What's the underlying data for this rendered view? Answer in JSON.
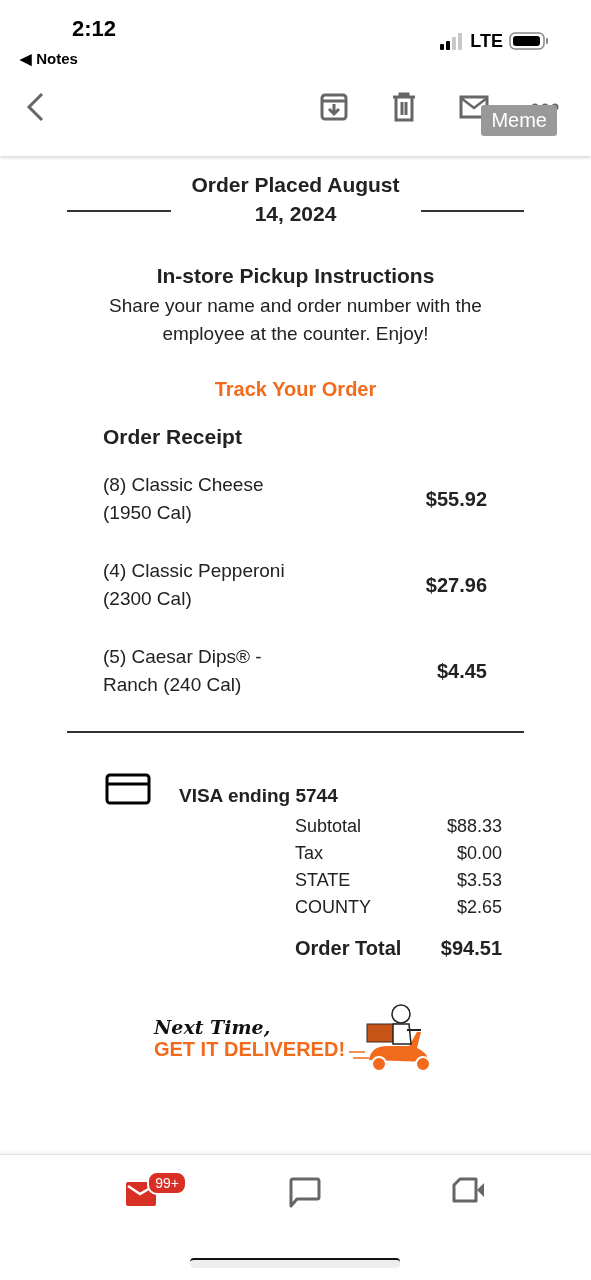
{
  "status_bar": {
    "time": "2:12",
    "back_app": "◀ Notes",
    "network": "LTE"
  },
  "toolbar": {
    "badge": "Meme"
  },
  "order": {
    "title": "Order Placed August 14, 2024",
    "instructions_title": "In-store Pickup Instructions",
    "instructions": "Share your name and order number with the employee at the counter. Enjoy!",
    "track_link": "Track Your Order",
    "receipt_title": "Order Receipt",
    "items": [
      {
        "name": "(8) Classic Cheese (1950 Cal)",
        "price": "$55.92"
      },
      {
        "name": "(4) Classic Pepperoni (2300 Cal)",
        "price": "$27.96"
      },
      {
        "name": "(5) Caesar Dips® - Ranch (240 Cal)",
        "price": "$4.45"
      }
    ],
    "payment": "VISA ending 5744",
    "totals": [
      {
        "label": "Subtotal",
        "value": "$88.33"
      },
      {
        "label": "Tax",
        "value": "$0.00"
      },
      {
        "label": "STATE",
        "value": "$3.53"
      },
      {
        "label": "COUNTY",
        "value": "$2.65"
      }
    ],
    "grand_total": {
      "label": "Order Total",
      "value": "$94.51"
    }
  },
  "promo": {
    "line1": "Next Time,",
    "line2": "GET IT DELIVERED!"
  },
  "bottom_nav": {
    "mail_badge": "99+"
  }
}
